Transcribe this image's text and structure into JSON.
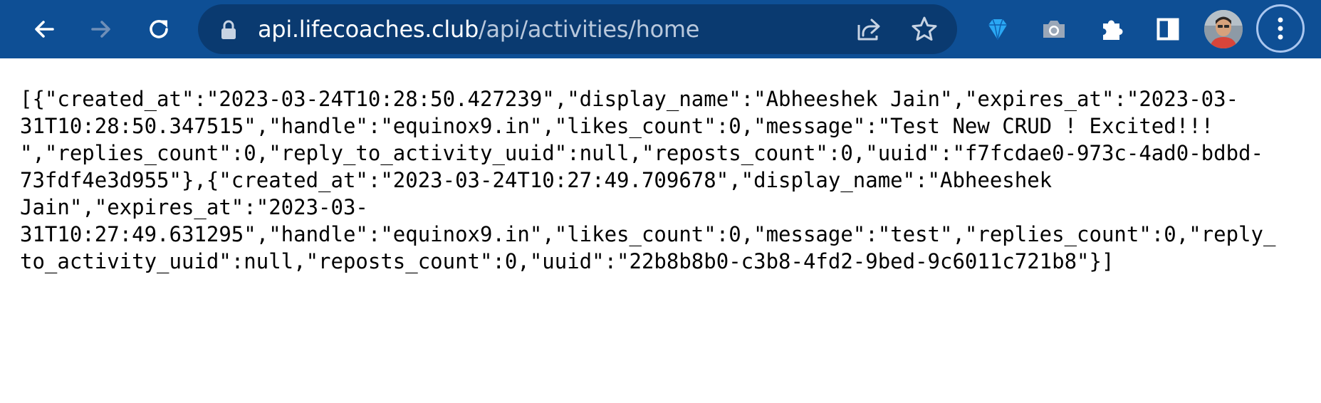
{
  "browser": {
    "url_host": "api.lifecoaches.club",
    "url_path": "/api/activities/home",
    "icons": {
      "back": "back-arrow-icon",
      "forward": "forward-arrow-icon",
      "reload": "reload-icon",
      "lock": "lock-icon",
      "share": "share-icon",
      "bookmark": "star-icon",
      "extension_1": "diamond-extension-icon",
      "extension_2": "camera-extension-icon",
      "extensions": "puzzle-icon",
      "side_panel": "side-panel-icon",
      "profile": "avatar",
      "menu": "kebab-menu-icon"
    },
    "colors": {
      "toolbar": "#0e4f95",
      "omnibox": "#0a3a70",
      "text": "#ffffff",
      "url_path": "#b9c8dc"
    }
  },
  "page": {
    "lines": [
      "[{\"created_at\":\"2023-03-24T10:28:50.427239\",\"display_name\":\"Abheeshek Jain\",\"expires_at\":\"2023-03-",
      "31T10:28:50.347515\",\"handle\":\"equinox9.in\",\"likes_count\":0,\"message\":\"Test New CRUD ! Excited!!!",
      "\",\"replies_count\":0,\"reply_to_activity_uuid\":null,\"reposts_count\":0,\"uuid\":\"f7fcdae0-973c-4ad0-bdbd-",
      "73fdf4e3d955\"},{\"created_at\":\"2023-03-24T10:27:49.709678\",\"display_name\":\"Abheeshek",
      "Jain\",\"expires_at\":\"2023-03-",
      "31T10:27:49.631295\",\"handle\":\"equinox9.in\",\"likes_count\":0,\"message\":\"test\",\"replies_count\":0,\"reply_",
      "to_activity_uuid\":null,\"reposts_count\":0,\"uuid\":\"22b8b8b0-c3b8-4fd2-9bed-9c6011c721b8\"}]"
    ]
  }
}
